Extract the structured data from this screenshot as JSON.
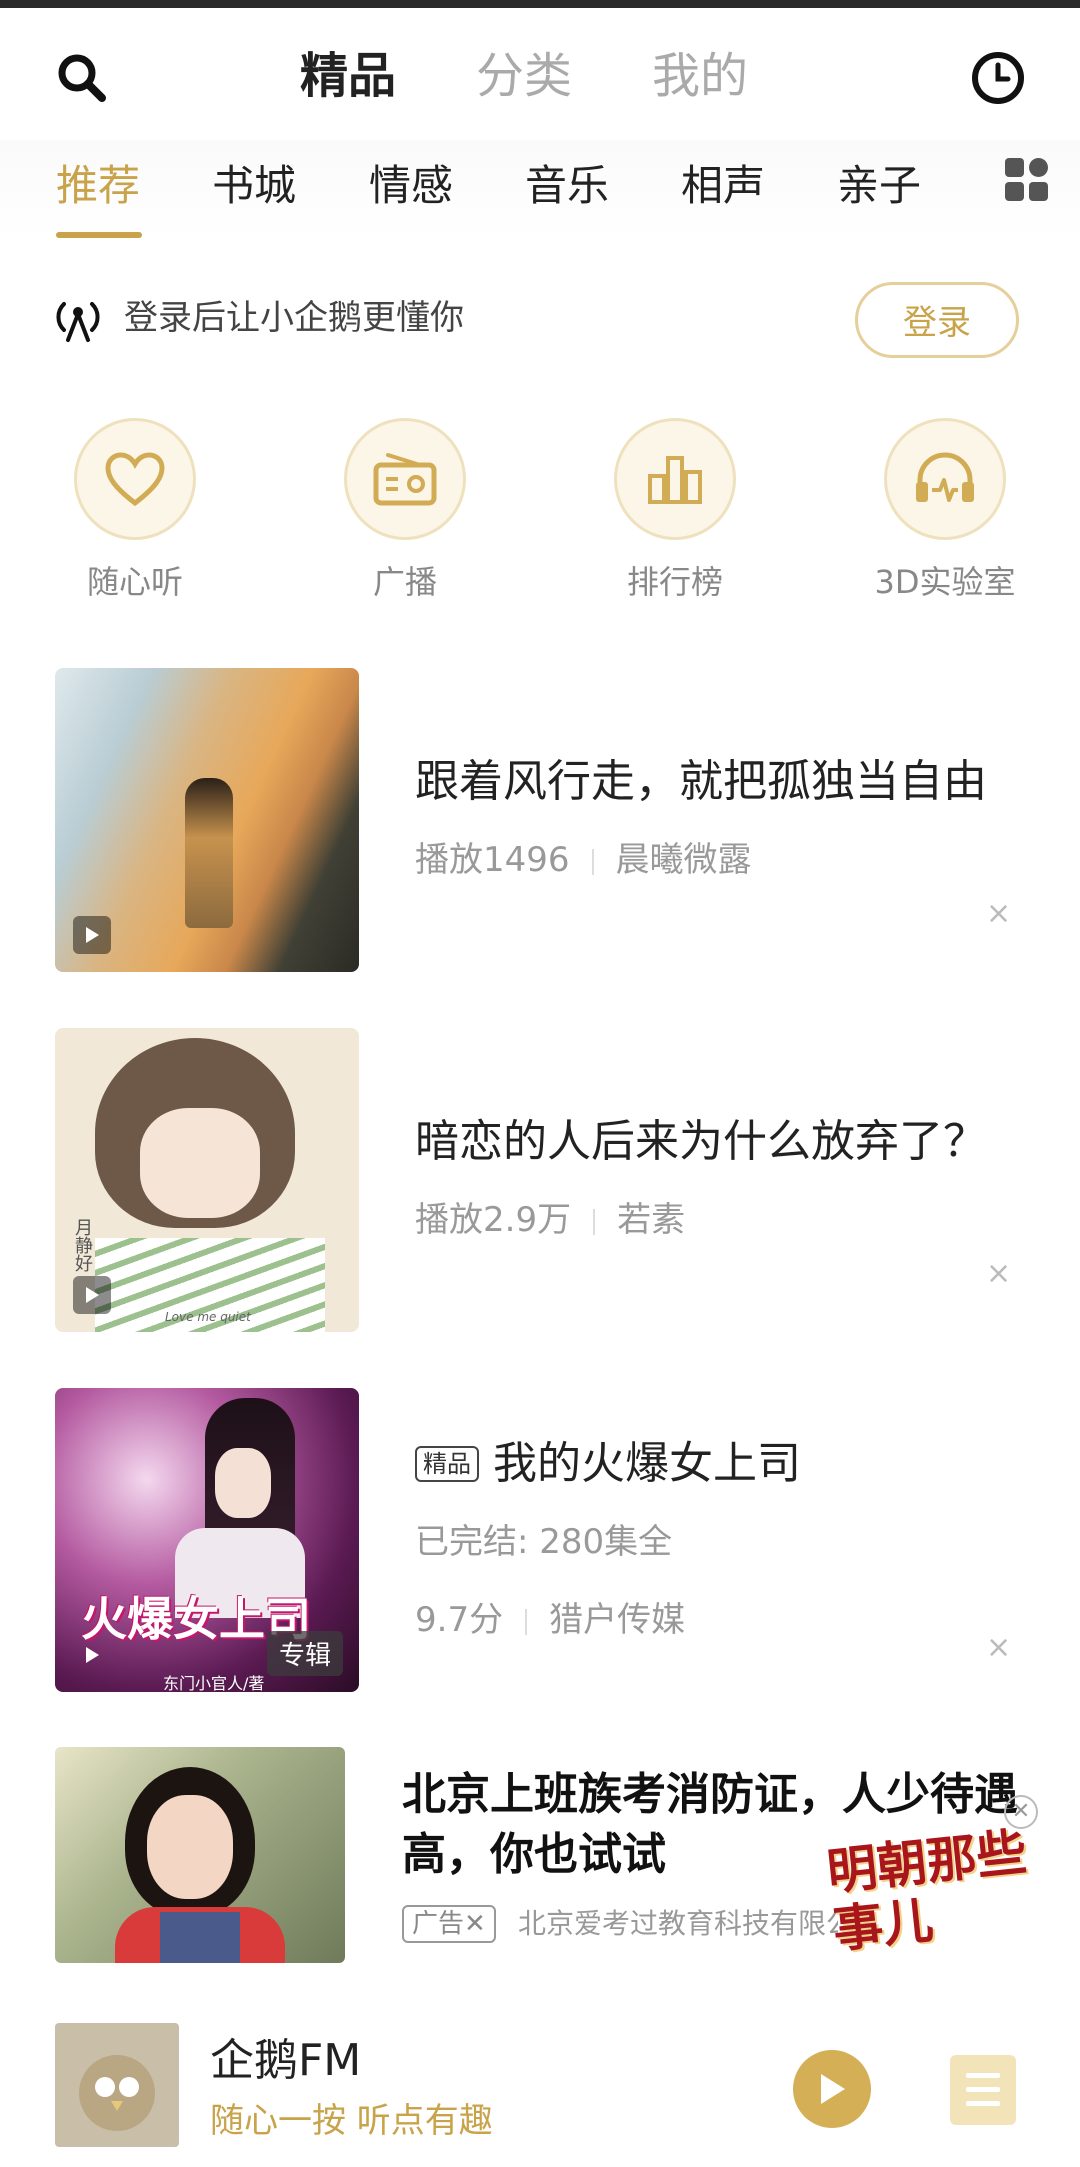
{
  "header": {
    "tabs": [
      {
        "label": "精品",
        "active": true
      },
      {
        "label": "分类",
        "active": false
      },
      {
        "label": "我的",
        "active": false
      }
    ]
  },
  "categories": {
    "items": [
      "推荐",
      "书城",
      "情感",
      "音乐",
      "相声",
      "亲子"
    ],
    "active_index": 0
  },
  "login": {
    "prompt": "登录后让小企鹅更懂你",
    "button": "登录"
  },
  "quick_actions": [
    {
      "label": "随心听",
      "icon": "heart-icon"
    },
    {
      "label": "广播",
      "icon": "radio-icon"
    },
    {
      "label": "排行榜",
      "icon": "chart-icon"
    },
    {
      "label": "3D实验室",
      "icon": "headphones-icon"
    }
  ],
  "feed": [
    {
      "title": "跟着风行走，就把孤独当自由",
      "plays": "播放1496",
      "author": "晨曦微露"
    },
    {
      "title": "暗恋的人后来为什么放弃了？",
      "plays": "播放2.9万",
      "author": "若素"
    },
    {
      "tag": "精品",
      "title": "我的火爆女上司",
      "status": "已完结: 280集全",
      "score": "9.7分",
      "author": "猎户传媒",
      "cover_text": "火爆女上司",
      "cover_author": "东门小官人/著",
      "cover_badge": "专辑"
    },
    {
      "cover_text_small": "月静好",
      "cover_caption": "Love me quiet"
    }
  ],
  "ad": {
    "title": "北京上班族考消防证，人少待遇高，你也试试",
    "tag": "广告✕",
    "source": "北京爱考过教育科技有限公司",
    "logo_text": "明朝那些事儿"
  },
  "player": {
    "title": "企鹅FM",
    "subtitle": "随心一按 听点有趣"
  },
  "colors": {
    "accent": "#c8a34a",
    "accent_light": "#fcf6e8"
  }
}
